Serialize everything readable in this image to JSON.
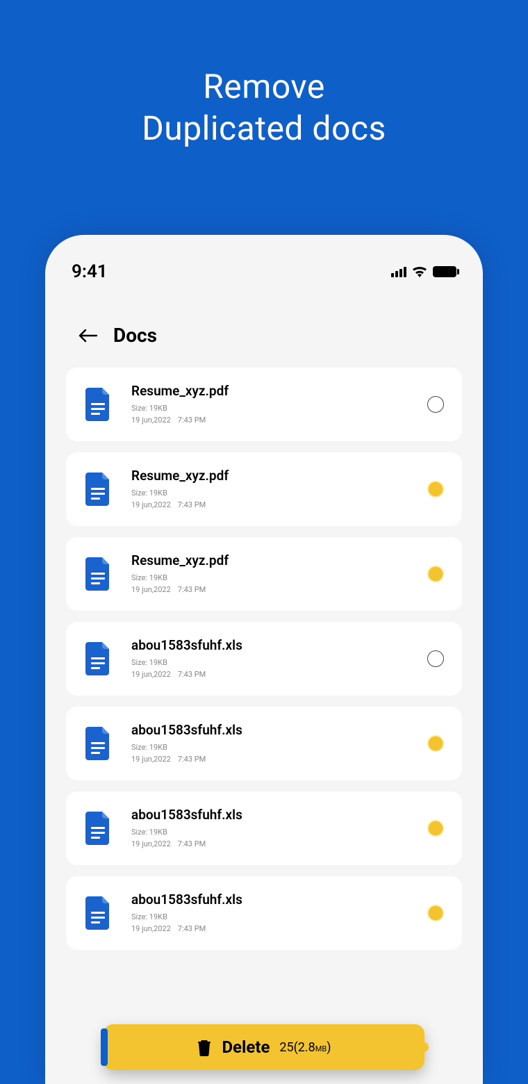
{
  "hero": {
    "line1": "Remove",
    "line2": "Duplicated docs"
  },
  "status": {
    "time": "9:41"
  },
  "header": {
    "title": "Docs"
  },
  "docs": [
    {
      "name": "Resume_xyz.pdf",
      "size": "Size: 19KB",
      "date": "19 jun,2022",
      "time": "7:43 PM",
      "selected": false
    },
    {
      "name": "Resume_xyz.pdf",
      "size": "Size: 19KB",
      "date": "19 jun,2022",
      "time": "7:43 PM",
      "selected": true
    },
    {
      "name": "Resume_xyz.pdf",
      "size": "Size: 19KB",
      "date": "19 jun,2022",
      "time": "7:43 PM",
      "selected": true
    },
    {
      "name": "abou1583sfuhf.xls",
      "size": "Size: 19KB",
      "date": "19 jun,2022",
      "time": "7:43 PM",
      "selected": false
    },
    {
      "name": "abou1583sfuhf.xls",
      "size": "Size: 19KB",
      "date": "19 jun,2022",
      "time": "7:43 PM",
      "selected": true
    },
    {
      "name": "abou1583sfuhf.xls",
      "size": "Size: 19KB",
      "date": "19 jun,2022",
      "time": "7:43 PM",
      "selected": true
    },
    {
      "name": "abou1583sfuhf.xls",
      "size": "Size: 19KB",
      "date": "19 jun,2022",
      "time": "7:43 PM",
      "selected": true
    }
  ],
  "delete": {
    "label": "Delete",
    "count": "25",
    "size_num": "(2.8",
    "size_unit": "MB",
    "close": ")"
  }
}
